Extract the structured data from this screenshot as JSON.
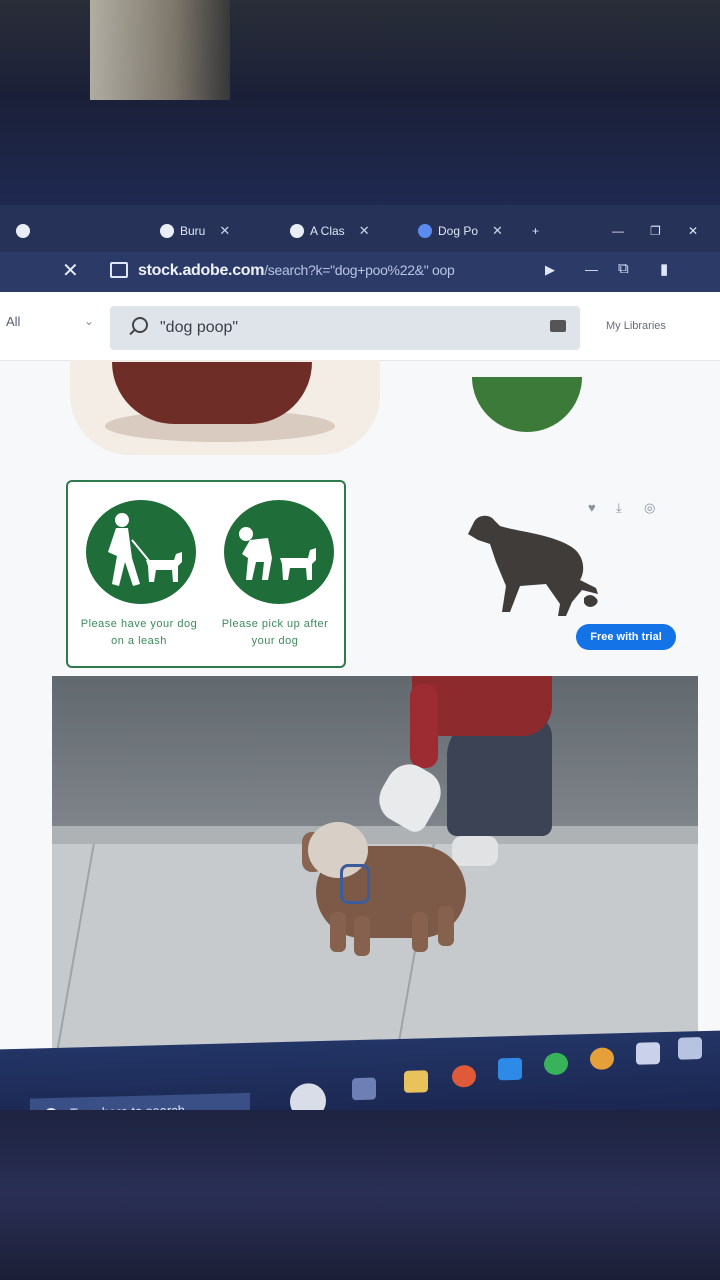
{
  "browser": {
    "tabs": [
      {
        "label": "Buru",
        "active": false
      },
      {
        "label": "A Clas",
        "active": false
      },
      {
        "label": "Dog Po",
        "active": true
      }
    ],
    "url_host": "stock.adobe.com",
    "url_rest": "/search?k=\"dog+poo%22&\" oop"
  },
  "search": {
    "filter": "All",
    "query": "\"dog poop\"",
    "my_libraries": "My Libraries"
  },
  "results": {
    "sign_captions": [
      "Please have your dog on a leash",
      "Please pick up after your dog"
    ],
    "trial_button": "Free with trial"
  },
  "taskbar": {
    "search_placeholder": "Type here to search"
  },
  "colors": {
    "accent": "#1473e6",
    "sign_green": "#1f6e3a"
  }
}
